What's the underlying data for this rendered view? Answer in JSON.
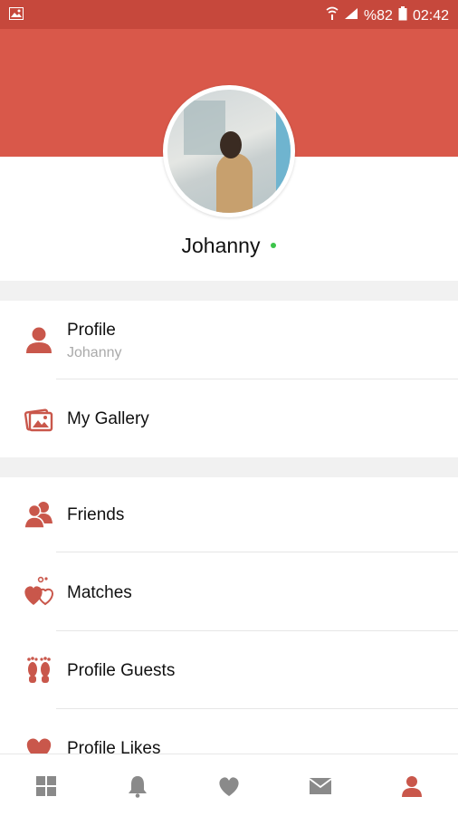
{
  "status_bar": {
    "battery": "%82",
    "time": "02:42"
  },
  "profile": {
    "name": "Johanny",
    "online": true
  },
  "menu": {
    "section1": [
      {
        "label": "Profile",
        "sublabel": "Johanny",
        "icon": "user-icon"
      },
      {
        "label": "My Gallery",
        "icon": "gallery-icon"
      }
    ],
    "section2": [
      {
        "label": "Friends",
        "icon": "friends-icon"
      },
      {
        "label": "Matches",
        "icon": "hearts-icon"
      },
      {
        "label": "Profile Guests",
        "icon": "footprints-icon"
      },
      {
        "label": "Profile Likes",
        "icon": "heart-icon"
      }
    ]
  },
  "bottom_nav": [
    {
      "name": "grid-icon",
      "active": false
    },
    {
      "name": "bell-icon",
      "active": false
    },
    {
      "name": "heart-icon",
      "active": false
    },
    {
      "name": "mail-icon",
      "active": false
    },
    {
      "name": "user-icon",
      "active": true
    }
  ],
  "colors": {
    "accent": "#d9584a",
    "status_bar": "#c6483c",
    "icon": "#c9574b",
    "inactive_nav": "#8a8a8a",
    "online": "#3cc44a"
  }
}
